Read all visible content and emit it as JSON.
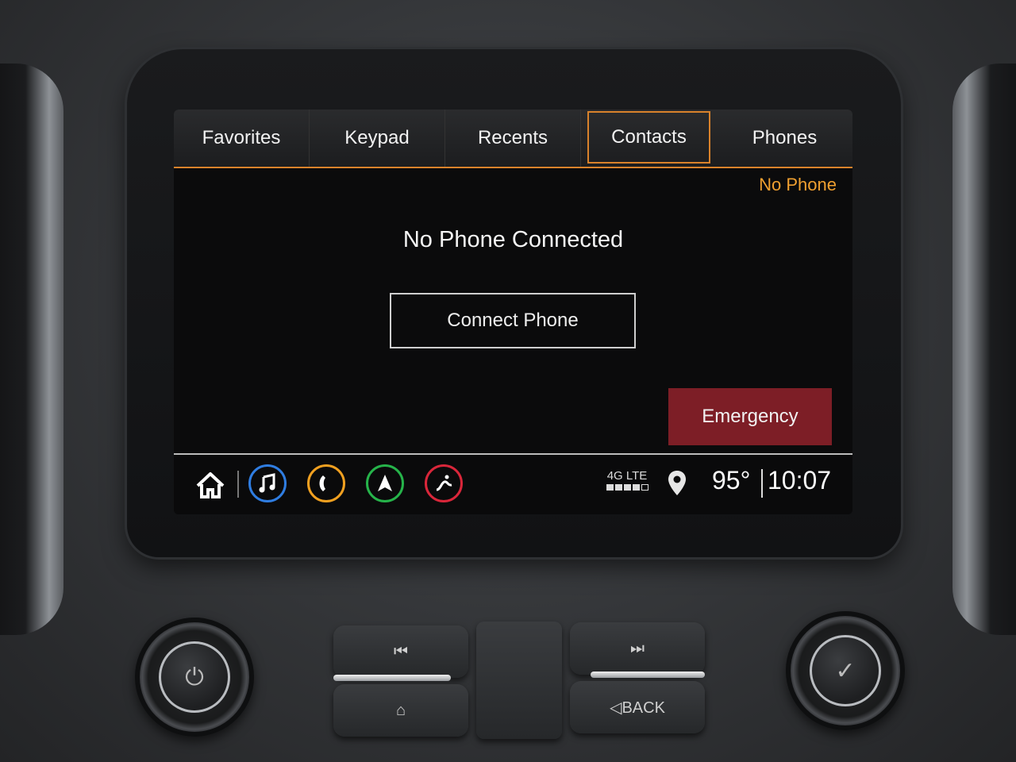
{
  "tabs": [
    {
      "label": "Favorites",
      "active": false
    },
    {
      "label": "Keypad",
      "active": false
    },
    {
      "label": "Recents",
      "active": false
    },
    {
      "label": "Contacts",
      "active": true
    },
    {
      "label": "Phones",
      "active": false
    }
  ],
  "status_notice": "No Phone",
  "main": {
    "title": "No Phone Connected",
    "connect_button": "Connect Phone",
    "emergency_button": "Emergency"
  },
  "statusbar": {
    "network": "4G LTE",
    "signal_bars": 4,
    "signal_max": 5,
    "temperature": "95°",
    "time": "10:07",
    "apps": [
      {
        "name": "music-app-icon",
        "color": "#2f7de1"
      },
      {
        "name": "phone-app-icon",
        "color": "#f0a020"
      },
      {
        "name": "navigation-app-icon",
        "color": "#26b34a"
      },
      {
        "name": "climate-app-icon",
        "color": "#d9263a"
      }
    ]
  },
  "hardware": {
    "back_label": "◁BACK"
  },
  "colors": {
    "accent": "#d9822b",
    "notice": "#f0a030",
    "emergency": "#7d1e26"
  }
}
